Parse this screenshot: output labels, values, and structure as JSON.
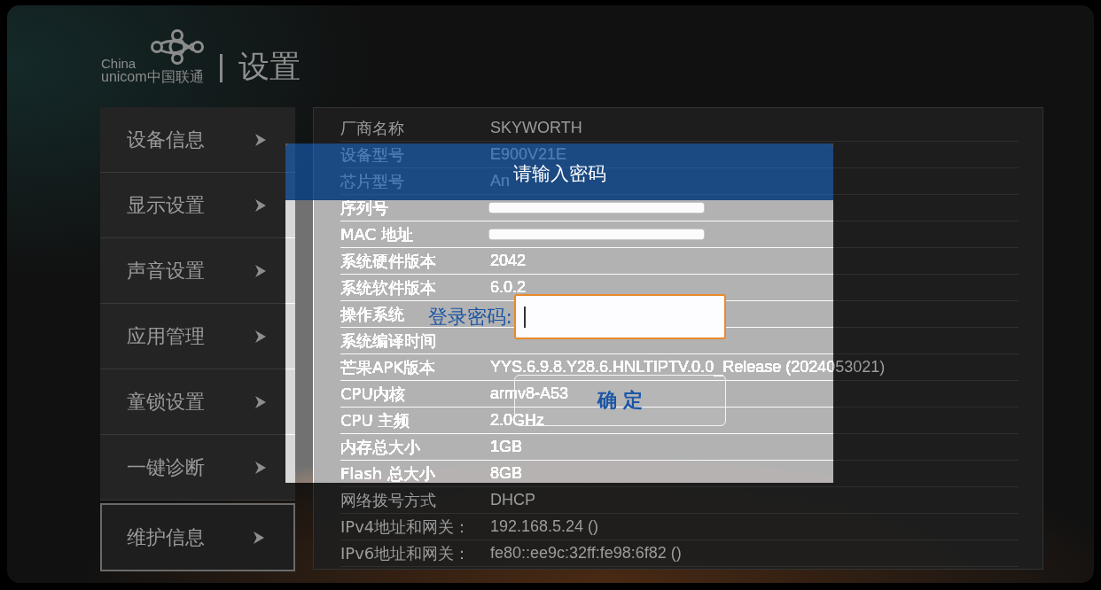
{
  "logo": {
    "line_1": "China",
    "line_2": "unicom中国联通"
  },
  "page_title": "设置",
  "sidebar": {
    "items": [
      {
        "label": "设备信息",
        "selected": false
      },
      {
        "label": "显示设置",
        "selected": false
      },
      {
        "label": "声音设置",
        "selected": false
      },
      {
        "label": "应用管理",
        "selected": false
      },
      {
        "label": "童锁设置",
        "selected": false
      },
      {
        "label": "一键诊断",
        "selected": false
      },
      {
        "label": "维护信息",
        "selected": true
      }
    ]
  },
  "info_table": {
    "rows": [
      {
        "label": "厂商名称",
        "value": "SKYWORTH"
      },
      {
        "label": "设备型号",
        "value": "E900V21E"
      },
      {
        "label": "芯片型号",
        "value": "An"
      },
      {
        "label": "序列号",
        "redacted": true
      },
      {
        "label": "MAC 地址",
        "redacted": true
      },
      {
        "label": "系统硬件版本",
        "value": "2042"
      },
      {
        "label": "系统软件版本",
        "value": "6.0.2"
      },
      {
        "label": "操作系统"
      },
      {
        "label": "系统编译时间"
      },
      {
        "label": "芒果APK版本",
        "value": "YYS.6.9.8.Y28.6.HNLTIPTV.0.0_Release (2024053021)"
      },
      {
        "label": "CPU内核",
        "value": "armv8-A53"
      },
      {
        "label": "CPU 主频",
        "value": "2.0GHz"
      },
      {
        "label": "内存总大小",
        "value": "1GB"
      },
      {
        "label": "Flash 总大小",
        "value": "8GB"
      },
      {
        "label": "网络拨号方式",
        "value": "DHCP"
      },
      {
        "label": "IPv4地址和网关：",
        "value": "192.168.5.24 ()"
      },
      {
        "label": "IPv6地址和网关：",
        "value": "fe80::ee9c:32ff:fe98:6f82 ()"
      }
    ]
  },
  "dialog": {
    "title": "请输入密码",
    "field_label": "登录密码:",
    "password_field": {
      "focused": true
    },
    "confirm_button": "确 定"
  }
}
